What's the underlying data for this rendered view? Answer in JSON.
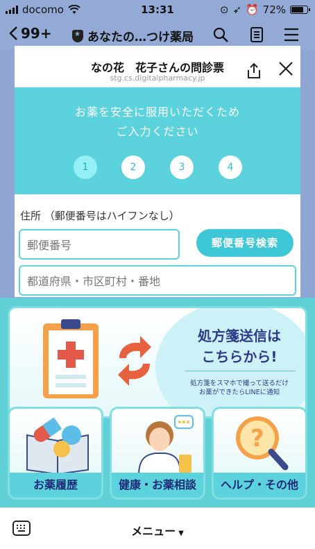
{
  "status_bar": {
    "carrier": "docomo",
    "time": "13:31",
    "battery": "72%"
  },
  "header": {
    "unread_count": "99+",
    "chat_title": "あなたの…つけ薬局"
  },
  "webview": {
    "title": "なの花　花子さんの問診票",
    "url": "stg.cs.digitalpharmacy.jp",
    "intro_line1": "お薬を安全に服用いただくため",
    "intro_line2": "ご入力ください",
    "steps": [
      "1",
      "2",
      "3",
      "4"
    ],
    "current_step": 1,
    "address_label": "住所 （郵便番号はハイフンなし）",
    "zip_placeholder": "郵便番号",
    "zip_search_label": "郵便番号検索",
    "address_placeholder": "都道府県・市区町村・番地"
  },
  "rich_menu": {
    "banner": {
      "headline1": "処方箋送信は",
      "headline2": "こちらから!",
      "sub1": "処方箋をスマホで撮って送るだけ",
      "sub2": "お薬ができたらLINEに通知"
    },
    "tiles": [
      {
        "label": "お薬履歴",
        "icon": "medicine-icon"
      },
      {
        "label": "健康・お薬相談",
        "icon": "pharmacist-icon"
      },
      {
        "label": "ヘルプ・その他",
        "icon": "help-magnifier-icon"
      }
    ]
  },
  "bottom_bar": {
    "menu_label": "メニュー"
  },
  "colors": {
    "header_bg": "#93aad6",
    "teal": "#5bd2dc",
    "navy_text": "#2f3a8a"
  }
}
